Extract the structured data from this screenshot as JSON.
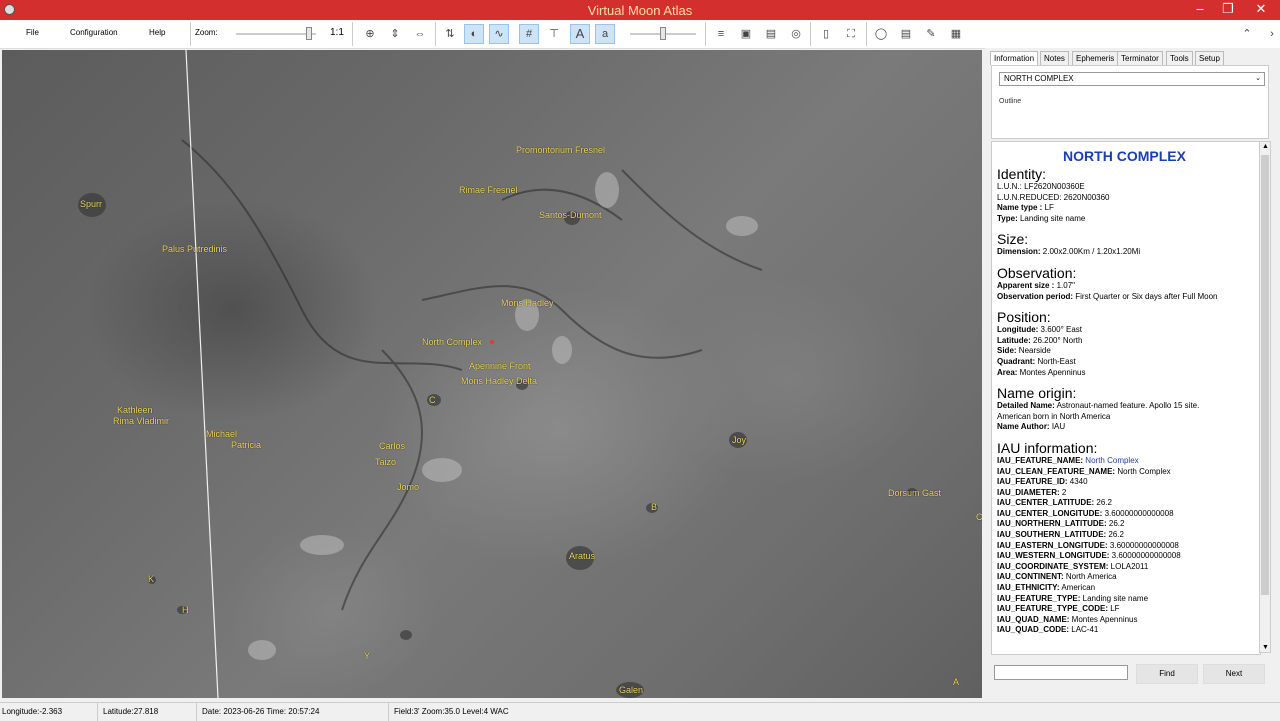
{
  "window": {
    "title": "Virtual Moon Atlas"
  },
  "menu": {
    "file": "File",
    "configuration": "Configuration",
    "help": "Help"
  },
  "toolbar": {
    "zoom_label": "Zoom:",
    "zoom_ratio": "1:1",
    "zoom_level": 0.95,
    "brightness_level": 0.5
  },
  "map_labels": [
    "Promontorium Fresnel",
    "Rimae Fresnel",
    "Santos-Dumont",
    "Spurr",
    "Palus Putredinis",
    "Mons Hadley",
    "North Complex",
    "Apennine Front",
    "Mons Hadley Delta",
    "C",
    "Kathleen",
    "Rima Vladimir",
    "Michael",
    "Patricia",
    "Carlos",
    "Taizo",
    "Jomo",
    "Joy",
    "Dorsum Gast",
    "B",
    "Aratus",
    "K",
    "H",
    "Y",
    "Galen",
    "A",
    "C"
  ],
  "panel": {
    "tabs": [
      "Information",
      "Notes",
      "Ephemeris",
      "Terminator",
      "Tools",
      "Setup"
    ],
    "selected_feature": "NORTH COMPLEX",
    "outline_label": "Outline",
    "title": "NORTH COMPLEX",
    "sections": [
      {
        "heading": "Identity:",
        "rows": [
          {
            "k": "L.U.N.:",
            "v": " LF2620N00360E",
            "bold": false
          },
          {
            "k": "L.U.N.REDUCED:",
            "v": " 2620N00360",
            "bold": false
          },
          {
            "k": "Name type :",
            "v": " LF",
            "bold": true
          },
          {
            "k": "Type:",
            "v": " Landing site name",
            "bold": true
          }
        ]
      },
      {
        "heading": "Size:",
        "rows": [
          {
            "k": "Dimension:",
            "v": " 2.00x2.00Km / 1.20x1.20Mi",
            "bold": true
          }
        ]
      },
      {
        "heading": "Observation:",
        "rows": [
          {
            "k": "Apparent size :",
            "v": " 1.07\"",
            "bold": true
          },
          {
            "k": "Observation period:",
            "v": " First Quarter or Six days after Full Moon",
            "bold": true
          }
        ]
      },
      {
        "heading": "Position:",
        "rows": [
          {
            "k": "Longitude:",
            "v": " 3.600° East",
            "bold": true
          },
          {
            "k": "Latitude:",
            "v": " 26.200° North",
            "bold": true
          },
          {
            "k": "Side:",
            "v": " Nearside",
            "bold": true
          },
          {
            "k": "Quadrant:",
            "v": " North-East",
            "bold": true
          },
          {
            "k": "Area:",
            "v": " Montes Apenninus",
            "bold": true
          }
        ]
      },
      {
        "heading": "Name origin:",
        "rows": [
          {
            "k": "Detailed Name:",
            "v": " Astronaut-named feature. Apollo 15 site.",
            "bold": true
          },
          {
            "k": "",
            "v": " American  born in North America",
            "bold": false
          },
          {
            "k": "Name Author:",
            "v": " IAU",
            "bold": true
          }
        ]
      },
      {
        "heading": "IAU information:",
        "rows": [
          {
            "k": "IAU_FEATURE_NAME:",
            "v": "  North Complex",
            "bold": true,
            "link": true
          },
          {
            "k": "IAU_CLEAN_FEATURE_NAME:",
            "v": " North Complex",
            "bold": true
          },
          {
            "k": "IAU_FEATURE_ID:",
            "v": " 4340",
            "bold": true
          },
          {
            "k": "IAU_DIAMETER:",
            "v": " 2",
            "bold": true
          },
          {
            "k": "IAU_CENTER_LATITUDE:",
            "v": " 26.2",
            "bold": true
          },
          {
            "k": "IAU_CENTER_LONGITUDE:",
            "v": " 3.60000000000008",
            "bold": true
          },
          {
            "k": "IAU_NORTHERN_LATITUDE:",
            "v": " 26.2",
            "bold": true
          },
          {
            "k": "IAU_SOUTHERN_LATITUDE:",
            "v": " 26.2",
            "bold": true
          },
          {
            "k": "IAU_EASTERN_LONGITUDE:",
            "v": " 3.60000000000008",
            "bold": true
          },
          {
            "k": "IAU_WESTERN_LONGITUDE:",
            "v": " 3.60000000000008",
            "bold": true
          },
          {
            "k": "IAU_COORDINATE_SYSTEM:",
            "v": " LOLA2011",
            "bold": true
          },
          {
            "k": "IAU_CONTINENT:",
            "v": " North America",
            "bold": true
          },
          {
            "k": "IAU_ETHNICITY:",
            "v": " American",
            "bold": true
          },
          {
            "k": "IAU_FEATURE_TYPE:",
            "v": " Landing site name",
            "bold": true
          },
          {
            "k": "IAU_FEATURE_TYPE_CODE:",
            "v": " LF",
            "bold": true
          },
          {
            "k": "IAU_QUAD_NAME:",
            "v": " Montes Apenninus",
            "bold": true
          },
          {
            "k": "IAU_QUAD_CODE:",
            "v": " LAC-41",
            "bold": true
          }
        ]
      }
    ],
    "find_button": "Find",
    "next_button": "Next"
  },
  "status": {
    "longitude": "Longitude:-2.363",
    "latitude": "Latitude:27.818",
    "date": "Date: 2023-06-26  Time: 20:57:24",
    "field": "Field:3' Zoom:35.0  Level:4 WAC"
  }
}
